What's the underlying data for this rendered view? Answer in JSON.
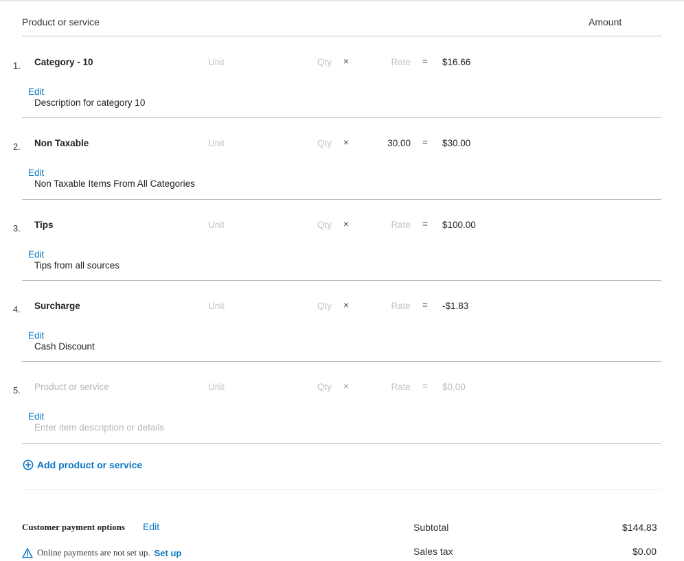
{
  "header": {
    "product_col": "Product or service",
    "amount_col": "Amount"
  },
  "lines": [
    {
      "num": "1.",
      "name": "Category - 10",
      "unit": "Unit",
      "qty": "Qty",
      "times": "×",
      "rate": "Rate",
      "equals": "=",
      "amount": "$16.66",
      "edit": "Edit",
      "description": "Description for category 10"
    },
    {
      "num": "2.",
      "name": "Non Taxable",
      "unit": "Unit",
      "qty": "Qty",
      "times": "×",
      "rate": "30.00",
      "equals": "=",
      "amount": "$30.00",
      "edit": "Edit",
      "description": "Non Taxable Items From All Categories"
    },
    {
      "num": "3.",
      "name": "Tips",
      "unit": "Unit",
      "qty": "Qty",
      "times": "×",
      "rate": "Rate",
      "equals": "=",
      "amount": "$100.00",
      "edit": "Edit",
      "description": "Tips from all sources"
    },
    {
      "num": "4.",
      "name": "Surcharge",
      "unit": "Unit",
      "qty": "Qty",
      "times": "×",
      "rate": "Rate",
      "equals": "=",
      "amount": "-$1.83",
      "edit": "Edit",
      "description": "Cash Discount"
    },
    {
      "num": "5.",
      "name": "Product or service",
      "unit": "Unit",
      "qty": "Qty",
      "times": "×",
      "rate": "Rate",
      "equals": "=",
      "amount": "$0.00",
      "edit": "Edit",
      "description": "Enter item description or details"
    }
  ],
  "add_button": {
    "label": "Add product or service",
    "icon": "plus-circle-icon"
  },
  "payment_options": {
    "label": "Customer payment options",
    "edit": "Edit",
    "warning_text": "Online payments are not set up.",
    "setup_link": "Set up",
    "warning_icon": "warning-triangle-icon"
  },
  "totals": {
    "subtotal_label": "Subtotal",
    "subtotal_value": "$144.83",
    "salestax_label": "Sales tax",
    "salestax_value": "$0.00"
  },
  "colors": {
    "link": "#0a77c6",
    "placeholder": "#b5b5b5",
    "rule": "#bdbdbd"
  }
}
